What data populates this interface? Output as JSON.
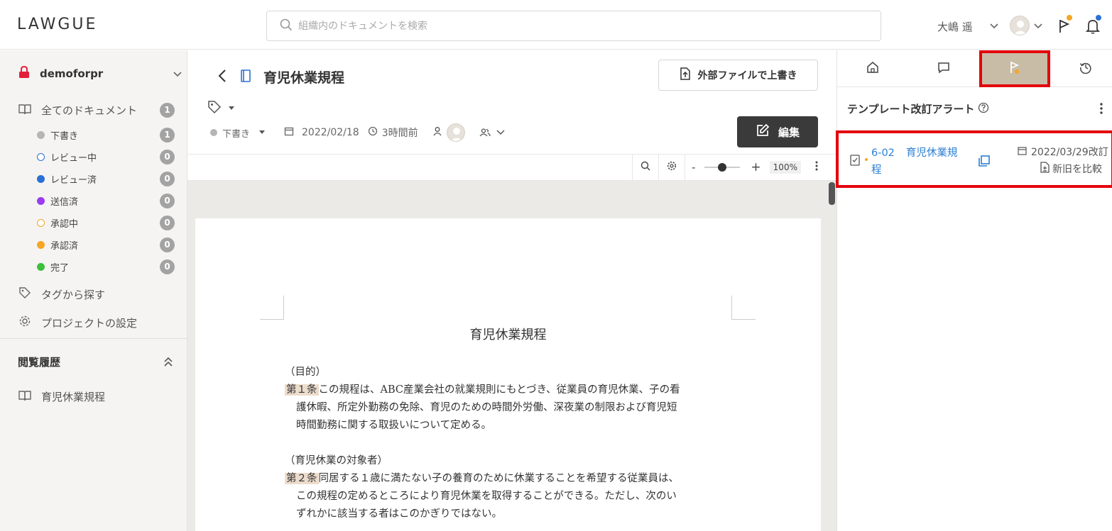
{
  "app": {
    "logo": "LAWGUE"
  },
  "header": {
    "search_placeholder": "組織内のドキュメントを検索",
    "user_name": "大嶋 遥",
    "colors": {
      "flag_dot": "#f5a623",
      "bell_dot": "#2b6fd6"
    }
  },
  "sidebar": {
    "project": "demoforpr",
    "all_docs": {
      "label": "全てのドキュメント",
      "count": "1"
    },
    "statuses": [
      {
        "label": "下書き",
        "count": "1",
        "color": "#b5b5b5",
        "hollow": false
      },
      {
        "label": "レビュー中",
        "count": "0",
        "color": "#2b6fd6",
        "hollow": true
      },
      {
        "label": "レビュー済",
        "count": "0",
        "color": "#2b6fd6",
        "hollow": false
      },
      {
        "label": "送信済",
        "count": "0",
        "color": "#9b3cf0",
        "hollow": false
      },
      {
        "label": "承認中",
        "count": "0",
        "color": "#f5a623",
        "hollow": true
      },
      {
        "label": "承認済",
        "count": "0",
        "color": "#f5a623",
        "hollow": false
      },
      {
        "label": "完了",
        "count": "0",
        "color": "#3cbf3c",
        "hollow": false
      }
    ],
    "tags": "タグから探す",
    "settings": "プロジェクトの設定",
    "history_title": "閲覧履歴",
    "history_items": [
      "育児休業規程"
    ]
  },
  "document": {
    "title": "育児休業規程",
    "overwrite_button": "外部ファイルで上書き",
    "status": "下書き",
    "date": "2022/02/18",
    "relative_time": "3時間前",
    "edit_button": "編集",
    "zoom_minus": "-",
    "zoom_plus": "+",
    "zoom_level": "100%",
    "zoom_fraction": 0.5,
    "body": {
      "heading": "育児休業規程",
      "sections": [
        {
          "caption": "（目的）",
          "article": "第１条",
          "lines": [
            "この規程は、ABC産業会社の就業規則にもとづき、従業員の育児休業、子の看",
            "護休暇、所定外勤務の免除、育児のための時間外労働、深夜業の制限および育児短",
            "時間勤務に関する取扱いについて定める。"
          ]
        },
        {
          "caption": "（育児休業の対象者）",
          "article": "第２条",
          "lines": [
            "同居する１歳に満たない子の養育のために休業することを希望する従業員は、",
            "この規程の定めるところにより育児休業を取得することができる。ただし、次のい",
            "ずれかに該当する者はこのかぎりではない。"
          ]
        }
      ]
    }
  },
  "right_panel": {
    "title": "テンプレート改訂アラート",
    "alert": {
      "code": "6-02",
      "name_line1": "育児休業規",
      "name_line2": "程",
      "date": "2022/03/29改訂",
      "compare": "新旧を比較"
    }
  }
}
